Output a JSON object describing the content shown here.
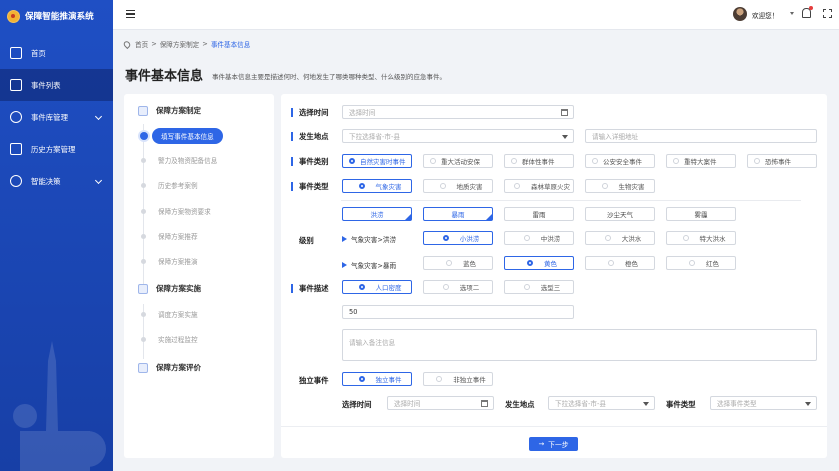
{
  "app": {
    "title": "保障智能推演系统"
  },
  "sidebar": {
    "items": [
      {
        "label": "首页"
      },
      {
        "label": "事件列表"
      },
      {
        "label": "事件库管理"
      },
      {
        "label": "历史方案管理"
      },
      {
        "label": "智能决策"
      }
    ]
  },
  "topbar": {
    "welcome": "欢迎您！"
  },
  "breadcrumb": {
    "items": [
      "首页",
      "保障方案制定",
      "事件基本信息"
    ],
    "separator": ">"
  },
  "page": {
    "title": "事件基本信息",
    "description": "事件基本信息主要是描述何时、何地发生了哪类哪种类型、什么级别的应急事件。"
  },
  "steps": {
    "groups": [
      {
        "title": "保障方案制定",
        "steps": [
          "填写事件基本信息",
          "警力及物资配备信息",
          "历史参考案例",
          "保障方案物资要求",
          "保障方案推荐",
          "保障方案推演"
        ]
      },
      {
        "title": "保障方案实施",
        "steps": [
          "调度方案实施",
          "实施过程监控"
        ]
      },
      {
        "title": "保障方案评价",
        "steps": []
      }
    ]
  },
  "form": {
    "time": {
      "label": "选择时间",
      "placeholder": "选择时间"
    },
    "place": {
      "label": "发生地点",
      "placeholder": "下拉选择省-市-县",
      "detail_placeholder": "请输入详细地址"
    },
    "category": {
      "label": "事件类别",
      "options": [
        "自然灾害时事件",
        "重大活动安保",
        "群体性事件",
        "公安安全事件",
        "重特大案件",
        "恐怖事件"
      ]
    },
    "type": {
      "label": "事件类型",
      "options": [
        "气象灾害",
        "地质灾害",
        "森林草原火灾",
        "生物灾害"
      ],
      "sub_options": [
        "洪涝",
        "暴雨",
        "雷雨",
        "沙尘天气",
        "雾霾"
      ]
    },
    "level": {
      "label": "级别",
      "rows": [
        {
          "tag": "气象灾害>洪涝",
          "options": [
            "小洪涝",
            "中洪涝",
            "大洪水",
            "特大洪水"
          ]
        },
        {
          "tag": "气象灾害>暴雨",
          "options": [
            "蓝色",
            "黄色",
            "橙色",
            "红色"
          ]
        }
      ]
    },
    "description": {
      "label": "事件描述",
      "options": [
        "人口密度",
        "选项二",
        "选型三"
      ],
      "value": "50",
      "remark_placeholder": "请输入备注信息"
    },
    "independent": {
      "label": "独立事件",
      "options": [
        "独立事件",
        "非独立事件"
      ],
      "time_label": "选择时间",
      "time_placeholder": "选择时间",
      "place_label": "发生地点",
      "place_placeholder": "下拉选择省-市-县",
      "type_label": "事件类型",
      "type_placeholder": "选择事件类型"
    },
    "next_label": "下一步"
  },
  "colors": {
    "primary": "#2e66e6",
    "sidebar": "#1f4fc4"
  }
}
